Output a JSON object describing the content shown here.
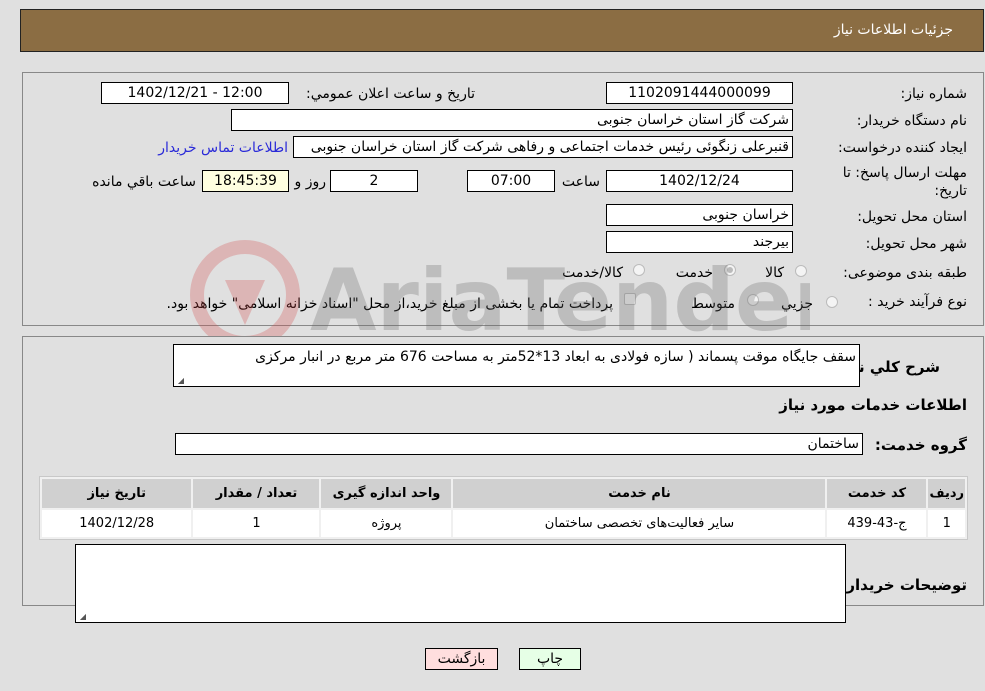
{
  "header": {
    "title": "جزئیات اطلاعات نیاز"
  },
  "form": {
    "need_number": {
      "label": "شماره نیاز:",
      "value": "1102091444000099"
    },
    "announce_datetime": {
      "label": "تاریخ و ساعت اعلان عمومي:",
      "value": "1402/12/21 - 12:00"
    },
    "buyer_org": {
      "label": "نام دستگاه خریدار:",
      "value": "شرکت گاز استان خراسان جنوبی"
    },
    "requester": {
      "label": "ایجاد کننده درخواست:",
      "value": "قنبرعلی زنگوئی رئیس خدمات اجتماعی و رفاهی شرکت گاز استان خراسان جنوبی",
      "contact_link": "اطلاعات تماس خریدار"
    },
    "deadline": {
      "label_line1": "مهلت ارسال پاسخ: تا",
      "label_line2": "تاریخ:",
      "date": "1402/12/24",
      "time_label": "ساعت",
      "time": "07:00",
      "days": "2",
      "days_label": "روز و",
      "remaining": "18:45:39",
      "remaining_label": "ساعت باقي مانده"
    },
    "province": {
      "label": "استان محل تحویل:",
      "value": "خراسان جنوبی"
    },
    "city": {
      "label": "شهر محل تحویل:",
      "value": "بیرجند"
    },
    "category": {
      "label": "طبقه بندی موضوعی:",
      "options": [
        "کالا",
        "خدمت",
        "کالا/خدمت"
      ],
      "selected": "خدمت"
    },
    "purchase_process": {
      "label": "نوع فرآیند خرید :",
      "options": [
        "جزيي",
        "متوسط"
      ],
      "note": "پرداخت تمام یا بخشی از مبلغ خرید،از محل \"اسناد خزانه اسلامی\" خواهد بود."
    }
  },
  "description": {
    "label": "شرح کلي نیاز:",
    "value": "سقف جایگاه موقت پسماند ( سازه فولادی به ابعاد 13*52متر به مساحت 676 متر مربع در انبار مرکزی"
  },
  "services": {
    "section_title": "اطلاعات خدمات مورد نیاز",
    "group_label": "گروه خدمت:",
    "group_value": "ساختمان",
    "columns": [
      "ردیف",
      "کد خدمت",
      "نام خدمت",
      "واحد اندازه گیری",
      "تعداد / مقدار",
      "تاریخ نیاز"
    ],
    "rows": [
      [
        "1",
        "ج-43-439",
        "سایر فعالیت‌های تخصصی ساختمان",
        "پروژه",
        "1",
        "1402/12/28"
      ]
    ]
  },
  "buyer_notes": {
    "label": "توضیحات خریدار:",
    "value": ""
  },
  "buttons": {
    "print": "چاپ",
    "back": "بازگشت"
  },
  "watermark": {
    "text": "AriaTender.neT"
  }
}
